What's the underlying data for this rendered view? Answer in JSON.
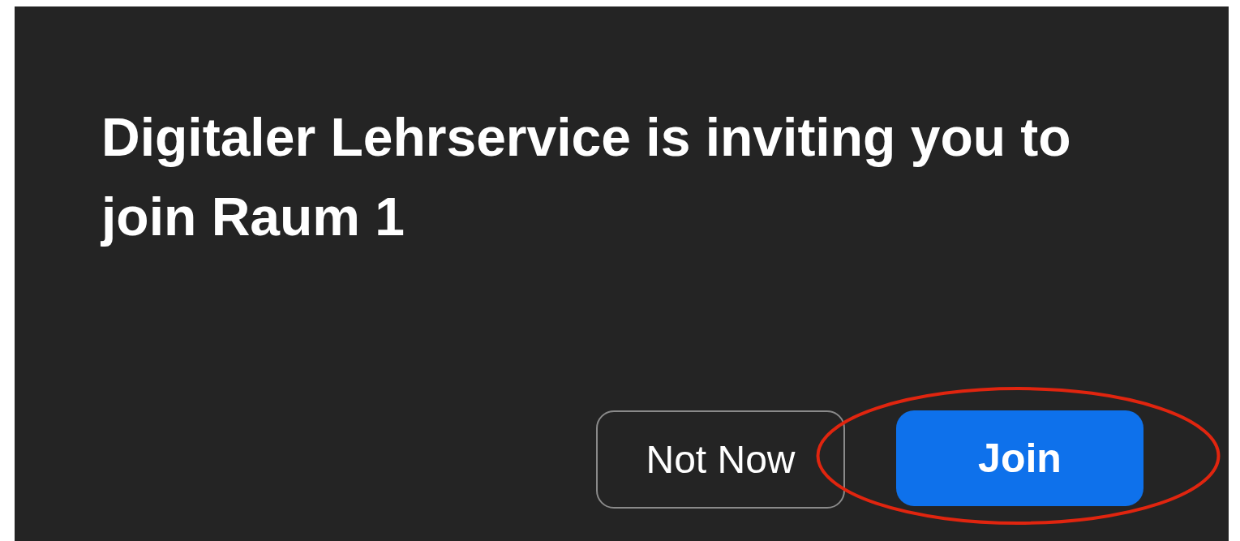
{
  "dialog": {
    "message": "Digitaler Lehrservice is inviting you to join Raum 1",
    "buttons": [
      {
        "label": "Not Now",
        "kind": "secondary",
        "highlighted": false
      },
      {
        "label": "Join",
        "kind": "primary",
        "highlighted": true
      }
    ]
  }
}
